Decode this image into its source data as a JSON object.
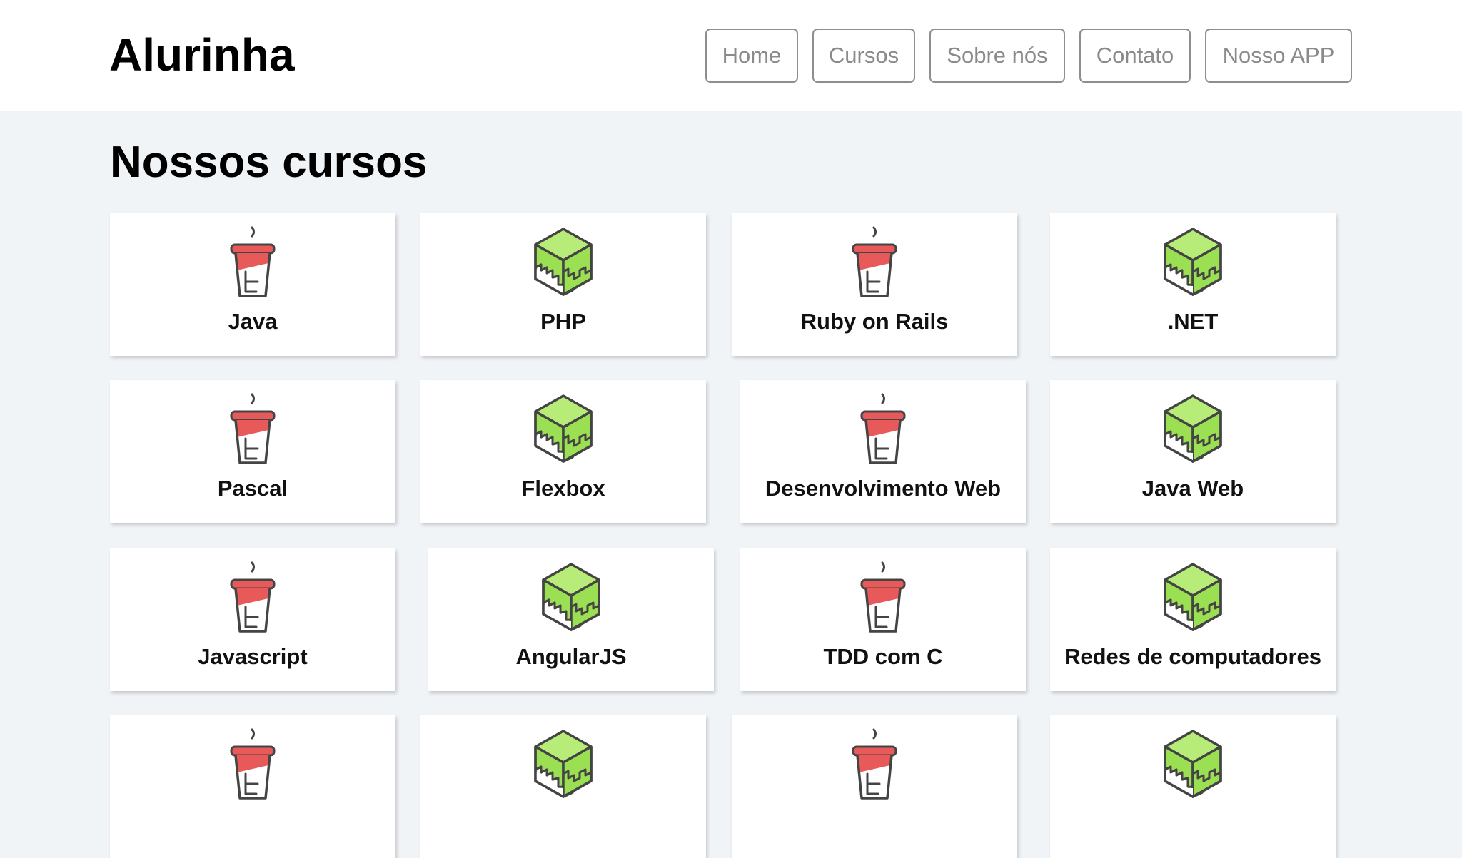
{
  "header": {
    "brand": "Alurinha",
    "nav": [
      "Home",
      "Cursos",
      "Sobre nós",
      "Contato",
      "Nosso APP"
    ]
  },
  "main": {
    "title": "Nossos cursos",
    "courses": [
      {
        "label": "Java",
        "icon": "coffee-cup-icon"
      },
      {
        "label": "PHP",
        "icon": "green-cube-icon"
      },
      {
        "label": "Ruby on Rails",
        "icon": "coffee-cup-icon"
      },
      {
        "label": ".NET",
        "icon": "green-cube-icon"
      },
      {
        "label": "Pascal",
        "icon": "coffee-cup-icon"
      },
      {
        "label": "Flexbox",
        "icon": "green-cube-icon"
      },
      {
        "label": "Desenvolvimento Web",
        "icon": "coffee-cup-icon"
      },
      {
        "label": "Java Web",
        "icon": "green-cube-icon"
      },
      {
        "label": "Javascript",
        "icon": "coffee-cup-icon"
      },
      {
        "label": "AngularJS",
        "icon": "green-cube-icon"
      },
      {
        "label": "TDD com C",
        "icon": "coffee-cup-icon"
      },
      {
        "label": "Redes de computadores",
        "icon": "green-cube-icon"
      },
      {
        "label": "",
        "icon": "coffee-cup-icon"
      },
      {
        "label": "",
        "icon": "green-cube-icon"
      },
      {
        "label": "",
        "icon": "coffee-cup-icon"
      },
      {
        "label": "",
        "icon": "green-cube-icon"
      }
    ]
  },
  "colors": {
    "cup_red": "#e8595a",
    "cube_green": "#9be052",
    "outline": "#444444",
    "page_bg": "#f1f4f7"
  }
}
